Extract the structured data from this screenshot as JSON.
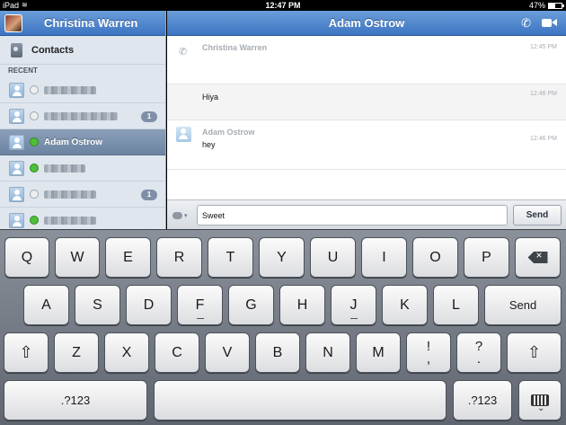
{
  "status_bar": {
    "device": "iPad",
    "time": "12:47 PM",
    "battery": "47%",
    "battery_level": 0.47
  },
  "sidebar": {
    "title": "Christina Warren",
    "contacts_label": "Contacts",
    "recent_label": "RECENT",
    "contacts": [
      {
        "name": "",
        "blurred": true,
        "badge": "",
        "status": "offline",
        "selected": false
      },
      {
        "name": "",
        "blurred": true,
        "badge": "1",
        "status": "offline",
        "selected": false
      },
      {
        "name": "Adam Ostrow",
        "blurred": false,
        "badge": "",
        "status": "online",
        "selected": true
      },
      {
        "name": "",
        "blurred": true,
        "badge": "",
        "status": "online",
        "selected": false
      },
      {
        "name": "",
        "blurred": true,
        "badge": "1",
        "status": "offline",
        "selected": false
      },
      {
        "name": "",
        "blurred": true,
        "badge": "",
        "status": "online",
        "selected": false
      }
    ]
  },
  "chat": {
    "title": "Adam Ostrow",
    "messages": [
      {
        "sender": "Christina Warren",
        "time": "12:45 PM",
        "text": ""
      },
      {
        "sender": "",
        "time": "12:46 PM",
        "text": "Hiya"
      },
      {
        "sender": "Adam Ostrow",
        "time": "12:46 PM",
        "text": "hey"
      }
    ],
    "input_value": "Sweet",
    "send_label": "Send"
  },
  "keyboard": {
    "row1": [
      "Q",
      "W",
      "E",
      "R",
      "T",
      "Y",
      "U",
      "I",
      "O",
      "P"
    ],
    "row2": [
      "A",
      "S",
      "D",
      "F",
      "G",
      "H",
      "J",
      "K",
      "L"
    ],
    "row3": [
      "Z",
      "X",
      "C",
      "V",
      "B",
      "N",
      "M"
    ],
    "punct1_top": "!",
    "punct1_bottom": ",",
    "punct2_top": "?",
    "punct2_bottom": ".",
    "send_key": "Send",
    "numbers_key": ".?123"
  }
}
